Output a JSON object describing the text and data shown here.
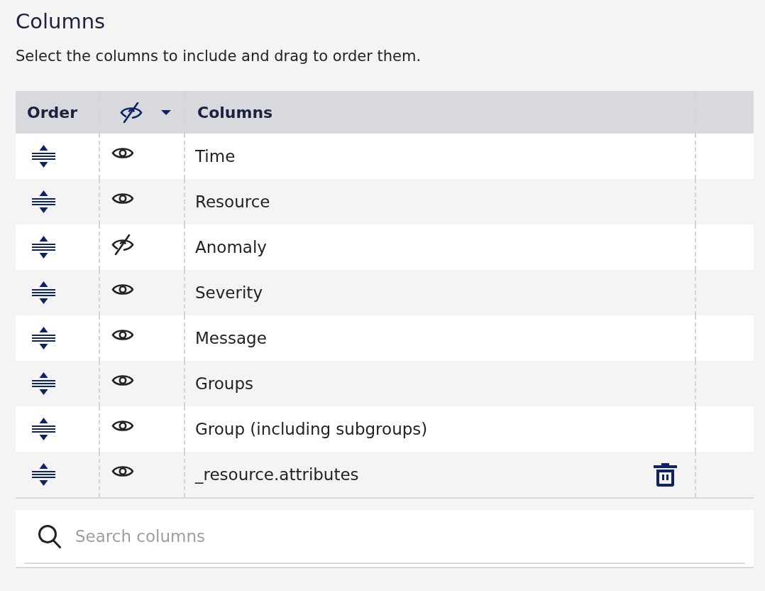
{
  "title": "Columns",
  "description": "Select the columns to include and drag to order them.",
  "table": {
    "columns": [
      "Order",
      "Columns"
    ],
    "rows": [
      {
        "name": "Time",
        "visible": true,
        "deletable": false
      },
      {
        "name": "Resource",
        "visible": true,
        "deletable": false
      },
      {
        "name": "Anomaly",
        "visible": false,
        "deletable": false
      },
      {
        "name": "Severity",
        "visible": true,
        "deletable": false
      },
      {
        "name": "Message",
        "visible": true,
        "deletable": false
      },
      {
        "name": "Groups",
        "visible": true,
        "deletable": false
      },
      {
        "name": "Group (including subgroups)",
        "visible": true,
        "deletable": false
      },
      {
        "name": "_resource.attributes",
        "visible": true,
        "deletable": true
      }
    ]
  },
  "search": {
    "placeholder": "Search columns"
  }
}
